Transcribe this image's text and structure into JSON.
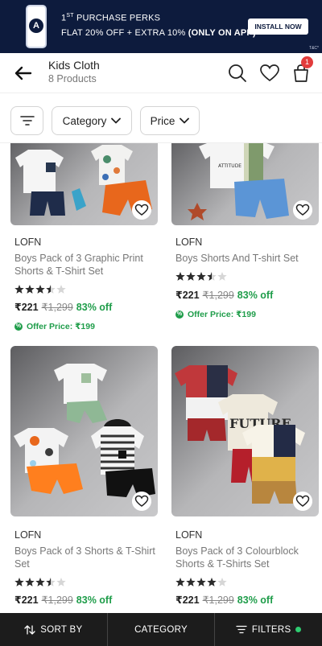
{
  "promo": {
    "line1_main": "1",
    "line1_sup": "ST",
    "line1_rest": " PURCHASE PERKS",
    "line2_plain": "FLAT 20% OFF + EXTRA 10% ",
    "line2_bold": "(ONLY ON APP)",
    "button": "INSTALL NOW",
    "tc": "T&C*",
    "logo_letter": "A"
  },
  "header": {
    "title": "Kids Cloth",
    "subtitle": "8 Products",
    "cart_count": "1"
  },
  "filters": {
    "category_label": "Category",
    "price_label": "Price"
  },
  "products": [
    {
      "brand": "LOFN",
      "name": "Boys Pack of 3 Graphic Print Shorts & T-Shirt Set",
      "rating": 3.5,
      "price": "₹221",
      "mrp": "₹1,299",
      "discount": "83% off",
      "offer": "Offer Price: ₹199"
    },
    {
      "brand": "LOFN",
      "name": "Boys Shorts And T-shirt Set",
      "rating": 3.5,
      "price": "₹221",
      "mrp": "₹1,299",
      "discount": "83% off",
      "offer": "Offer Price: ₹199",
      "print": "ATTITUDE"
    },
    {
      "brand": "LOFN",
      "name": "Boys Pack of 3 Shorts & T-Shirt Set",
      "rating": 3.5,
      "price": "₹221",
      "mrp": "₹1,299",
      "discount": "83% off"
    },
    {
      "brand": "LOFN",
      "name": "Boys Pack of 3 Colourblock Shorts & T-Shirts Set",
      "rating": 4,
      "price": "₹221",
      "mrp": "₹1,299",
      "discount": "83% off",
      "print": "FUTURE"
    }
  ],
  "bottom_bar": {
    "sort": "SORT BY",
    "category": "CATEGORY",
    "filters": "FILTERS"
  },
  "colors": {
    "banner_bg": "#0d1b3d",
    "discount_green": "#1f9d4a",
    "badge_red": "#e23b3b",
    "bottom_bar_bg": "#1c1c1c"
  },
  "icons": [
    "back-arrow-icon",
    "search-icon",
    "heart-icon",
    "cart-icon",
    "filter-icon",
    "chevron-down-icon",
    "sort-icon",
    "offer-icon"
  ]
}
